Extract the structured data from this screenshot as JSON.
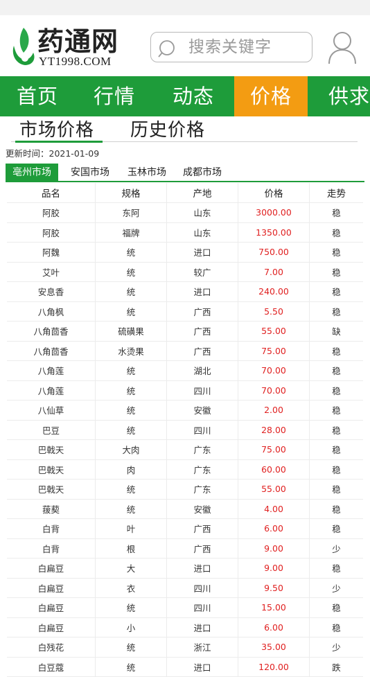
{
  "header": {
    "logo_text": "药通网",
    "logo_sub": "YT1998.COM",
    "search_placeholder": "搜索关键字"
  },
  "nav": {
    "items": [
      {
        "label": "首页",
        "active": false
      },
      {
        "label": "行情",
        "active": false
      },
      {
        "label": "动态",
        "active": false
      },
      {
        "label": "价格",
        "active": true
      },
      {
        "label": "供求",
        "active": false
      }
    ]
  },
  "subtabs": [
    {
      "label": "市场价格",
      "active": true
    },
    {
      "label": "历史价格",
      "active": false
    }
  ],
  "update_time": "更新时间：2021-01-09",
  "markets": [
    {
      "label": "亳州市场",
      "active": true
    },
    {
      "label": "安国市场",
      "active": false
    },
    {
      "label": "玉林市场",
      "active": false
    },
    {
      "label": "成都市场",
      "active": false
    }
  ],
  "colors": {
    "green": "#1e9c3a",
    "orange": "#f39c12",
    "price_red": "#e02020"
  },
  "table": {
    "headers": [
      "品名",
      "规格",
      "产地",
      "价格",
      "走势"
    ],
    "rows": [
      [
        "阿胶",
        "东阿",
        "山东",
        "3000.00",
        "稳"
      ],
      [
        "阿胶",
        "福牌",
        "山东",
        "1350.00",
        "稳"
      ],
      [
        "阿魏",
        "统",
        "进口",
        "750.00",
        "稳"
      ],
      [
        "艾叶",
        "统",
        "较广",
        "7.00",
        "稳"
      ],
      [
        "安息香",
        "统",
        "进口",
        "240.00",
        "稳"
      ],
      [
        "八角枫",
        "统",
        "广西",
        "5.50",
        "稳"
      ],
      [
        "八角茴香",
        "硫磺果",
        "广西",
        "55.00",
        "缺"
      ],
      [
        "八角茴香",
        "水烫果",
        "广西",
        "75.00",
        "稳"
      ],
      [
        "八角莲",
        "统",
        "湖北",
        "70.00",
        "稳"
      ],
      [
        "八角莲",
        "统",
        "四川",
        "70.00",
        "稳"
      ],
      [
        "八仙草",
        "统",
        "安徽",
        "2.00",
        "稳"
      ],
      [
        "巴豆",
        "统",
        "四川",
        "28.00",
        "稳"
      ],
      [
        "巴戟天",
        "大肉",
        "广东",
        "75.00",
        "稳"
      ],
      [
        "巴戟天",
        "肉",
        "广东",
        "60.00",
        "稳"
      ],
      [
        "巴戟天",
        "统",
        "广东",
        "55.00",
        "稳"
      ],
      [
        "菝葜",
        "统",
        "安徽",
        "4.00",
        "稳"
      ],
      [
        "白背",
        "叶",
        "广西",
        "6.00",
        "稳"
      ],
      [
        "白背",
        "根",
        "广西",
        "9.00",
        "少"
      ],
      [
        "白扁豆",
        "大",
        "进口",
        "9.00",
        "稳"
      ],
      [
        "白扁豆",
        "衣",
        "四川",
        "9.50",
        "少"
      ],
      [
        "白扁豆",
        "统",
        "四川",
        "15.00",
        "稳"
      ],
      [
        "白扁豆",
        "小",
        "进口",
        "6.00",
        "稳"
      ],
      [
        "白残花",
        "统",
        "浙江",
        "35.00",
        "少"
      ],
      [
        "白豆蔻",
        "统",
        "进口",
        "120.00",
        "跌"
      ]
    ]
  }
}
